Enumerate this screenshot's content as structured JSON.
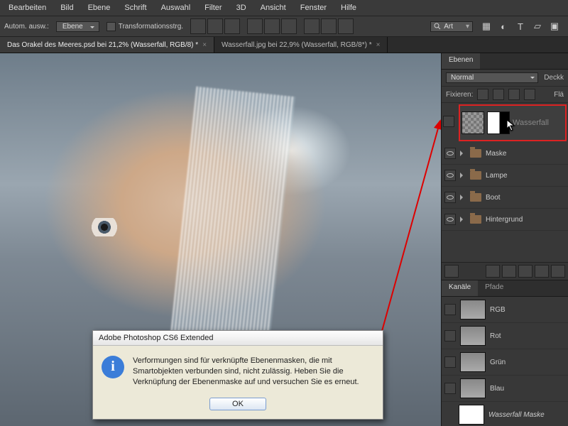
{
  "menu": [
    "Bearbeiten",
    "Bild",
    "Ebene",
    "Schrift",
    "Auswahl",
    "Filter",
    "3D",
    "Ansicht",
    "Fenster",
    "Hilfe"
  ],
  "options": {
    "autoselect_label": "Autom. ausw.:",
    "autoselect_value": "Ebene",
    "transform_label": "Transformationsstrg."
  },
  "search": {
    "prefix": "ρ",
    "label": "Art"
  },
  "tabs": [
    {
      "label": "Das Orakel des Meeres.psd bei 21,2%  (Wasserfall, RGB/8) *",
      "active": true
    },
    {
      "label": "Wasserfall.jpg bei 22,9% (Wasserfall, RGB/8*) *",
      "active": false
    }
  ],
  "panels": {
    "layers_tab": "Ebenen",
    "blend_mode": "Normal",
    "opacity_label": "Deckk",
    "lock_label": "Fixieren:",
    "fill_label": "Flä",
    "selected_layer": "Wasserfall",
    "groups": [
      "Maske",
      "Lampe",
      "Boot",
      "Hintergrund"
    ],
    "channels_tab": "Kanäle",
    "paths_tab": "Pfade",
    "channels": [
      "RGB",
      "Rot",
      "Grün",
      "Blau",
      "Wasserfall Maske"
    ]
  },
  "dialog": {
    "title": "Adobe Photoshop CS6 Extended",
    "message": "Verformungen sind für verknüpfte Ebenenmasken, die mit Smartobjekten verbunden sind, nicht zulässig. Heben Sie die Verknüpfung der Ebenenmaske auf und versuchen Sie es erneut.",
    "ok": "OK"
  }
}
